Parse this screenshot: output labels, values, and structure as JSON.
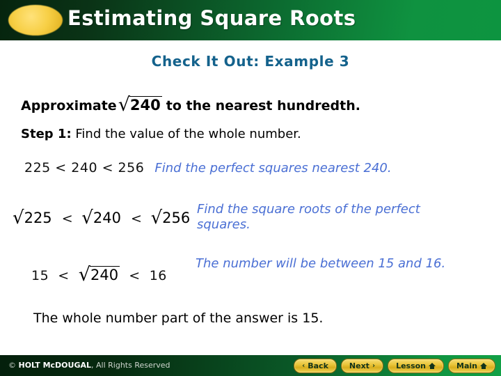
{
  "header": {
    "title": "Estimating Square Roots",
    "ellipse_color": "#f2c938",
    "gradient_from": "#06240e",
    "gradient_to": "#0d9440"
  },
  "subtitle": "Check It Out: Example 3",
  "problem": {
    "prefix": "Approximate",
    "radical_sign": "√",
    "radicand": "240",
    "suffix": "to the nearest hundredth."
  },
  "step1": {
    "label": "Step 1:",
    "text": "Find the value of the whole number."
  },
  "inequality1": {
    "expression": "225 < 240 < 256",
    "note": "Find the perfect squares nearest 240."
  },
  "inequality2": {
    "sign": "√",
    "left": "225",
    "op1": "<",
    "middle": "240",
    "op2": "<",
    "right": "256",
    "note": "Find the square roots of the perfect squares."
  },
  "inequality3": {
    "left": "15",
    "op1": "<",
    "sign": "√",
    "radicand": "240",
    "op2": "<",
    "right": "16",
    "note": "The number will be between 15 and 16."
  },
  "conclusion": "The whole number part of the answer is 15.",
  "footer": {
    "copyright_symbol": "©",
    "copyright_bold": "HOLT McDOUGAL",
    "copyright_rest": ", All Rights Reserved",
    "buttons": [
      {
        "label": "Back",
        "icon": "chevron-left-icon",
        "glyph": "‹"
      },
      {
        "label": "Next",
        "icon": "chevron-right-icon",
        "glyph": "›"
      },
      {
        "label": "Lesson",
        "icon": "home-icon",
        "glyph": ""
      },
      {
        "label": "Main",
        "icon": "home-icon",
        "glyph": ""
      }
    ]
  },
  "colors": {
    "accent_green": "#0d9440",
    "gold": "#e9c438",
    "note_blue": "#4a6fd4",
    "subtitle_blue": "#14628c"
  }
}
